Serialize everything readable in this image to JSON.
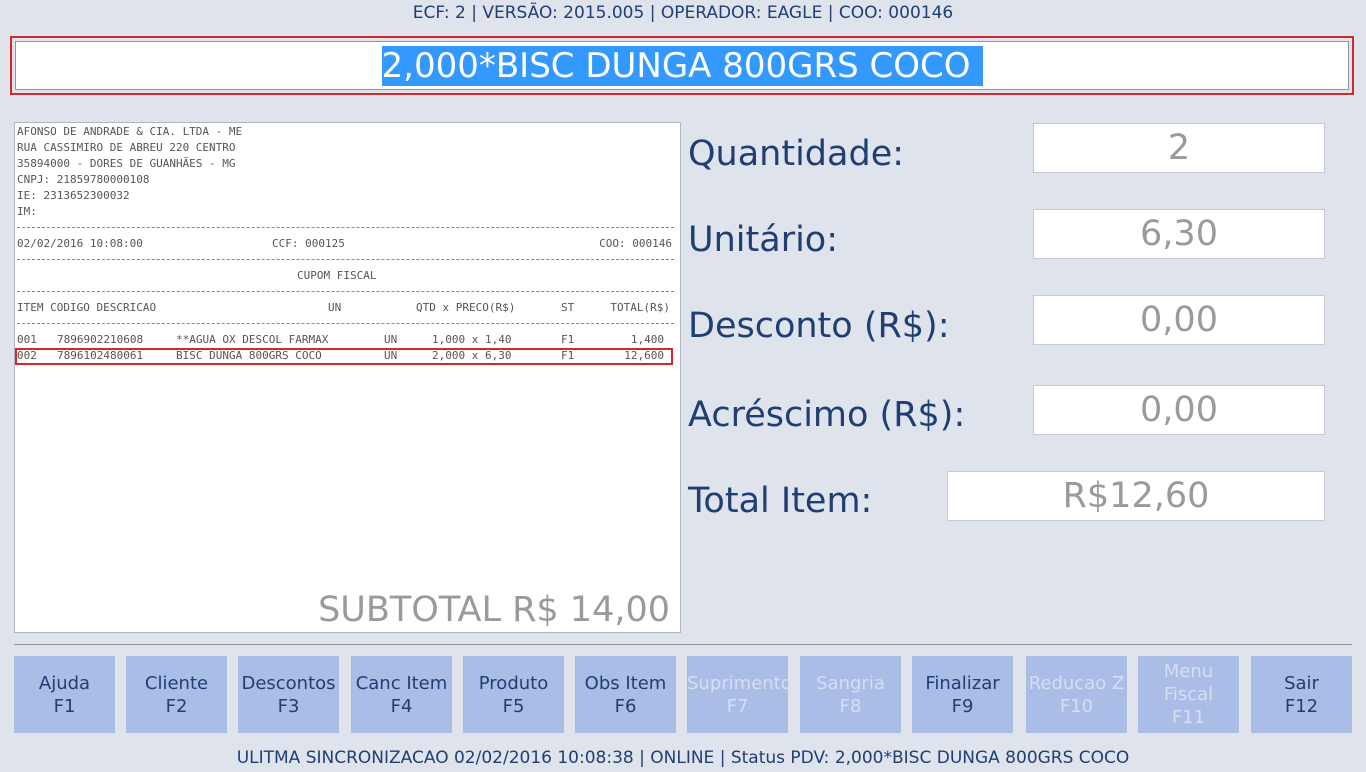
{
  "header": {
    "info": "ECF: 2 | VERSÃO: 2015.005 | OPERADOR: EAGLE | COO: 000146"
  },
  "command_input": {
    "value": "2,000*BISC DUNGA 800GRS COCO"
  },
  "receipt": {
    "company": "AFONSO DE ANDRADE & CIA. LTDA - ME",
    "address": "RUA CASSIMIRO DE ABREU 220 CENTRO",
    "city": "35894000 - DORES DE GUANHÃES - MG",
    "cnpj": "CNPJ: 21859780000108",
    "ie": "IE: 2313652300032",
    "im": "IM:",
    "datetime": "02/02/2016 10:08:00",
    "ccf": "CCF: 000125",
    "coo": "COO: 000146",
    "title": "CUPOM FISCAL",
    "columns": {
      "left": "ITEM CODIGO DESCRICAO",
      "un": "UN",
      "qtd_preco": "QTD x PRECO(R$)",
      "st": "ST",
      "total": "TOTAL(R$)"
    },
    "items": [
      {
        "item": "001",
        "codigo": "7896902210608",
        "descricao": "**AGUA OX DESCOL FARMAX",
        "un": "UN",
        "qtd_preco": "1,000 x 1,40",
        "st": "F1",
        "total": "1,400"
      },
      {
        "item": "002",
        "codigo": "7896102480061",
        "descricao": "BISC DUNGA 800GRS COCO",
        "un": "UN",
        "qtd_preco": "2,000 x 6,30",
        "st": "F1",
        "total": "12,600"
      }
    ],
    "subtotal": "SUBTOTAL R$ 14,00"
  },
  "fields": {
    "quantidade": {
      "label": "Quantidade:",
      "value": "2"
    },
    "unitario": {
      "label": "Unitário:",
      "value": "6,30"
    },
    "desconto": {
      "label": "Desconto (R$):",
      "value": "0,00"
    },
    "acrescimo": {
      "label": "Acréscimo (R$):",
      "value": "0,00"
    },
    "total_item": {
      "label": "Total Item:",
      "value": "R$12,60"
    }
  },
  "function_keys": [
    {
      "label": "Ajuda",
      "key": "F1",
      "enabled": true
    },
    {
      "label": "Cliente",
      "key": "F2",
      "enabled": true
    },
    {
      "label": "Descontos",
      "key": "F3",
      "enabled": true
    },
    {
      "label": "Canc Item",
      "key": "F4",
      "enabled": true
    },
    {
      "label": "Produto",
      "key": "F5",
      "enabled": true
    },
    {
      "label": "Obs Item",
      "key": "F6",
      "enabled": true
    },
    {
      "label": "Suprimento",
      "key": "F7",
      "enabled": false
    },
    {
      "label": "Sangria",
      "key": "F8",
      "enabled": false
    },
    {
      "label": "Finalizar",
      "key": "F9",
      "enabled": true
    },
    {
      "label": "Reducao Z",
      "key": "F10",
      "enabled": false
    },
    {
      "label": "Menu Fiscal",
      "key": "F11",
      "enabled": false
    },
    {
      "label": "Sair",
      "key": "F12",
      "enabled": true
    }
  ],
  "status_bar": {
    "text": "ULITMA SINCRONIZACAO 02/02/2016 10:08:38 | ONLINE | Status PDV: 2,000*BISC DUNGA 800GRS COCO"
  },
  "colors": {
    "background": "#dfe3ec",
    "text_primary": "#1f3f74",
    "button": "#a9bde6",
    "highlight_border": "#d8262d",
    "selection": "#3399ff"
  }
}
